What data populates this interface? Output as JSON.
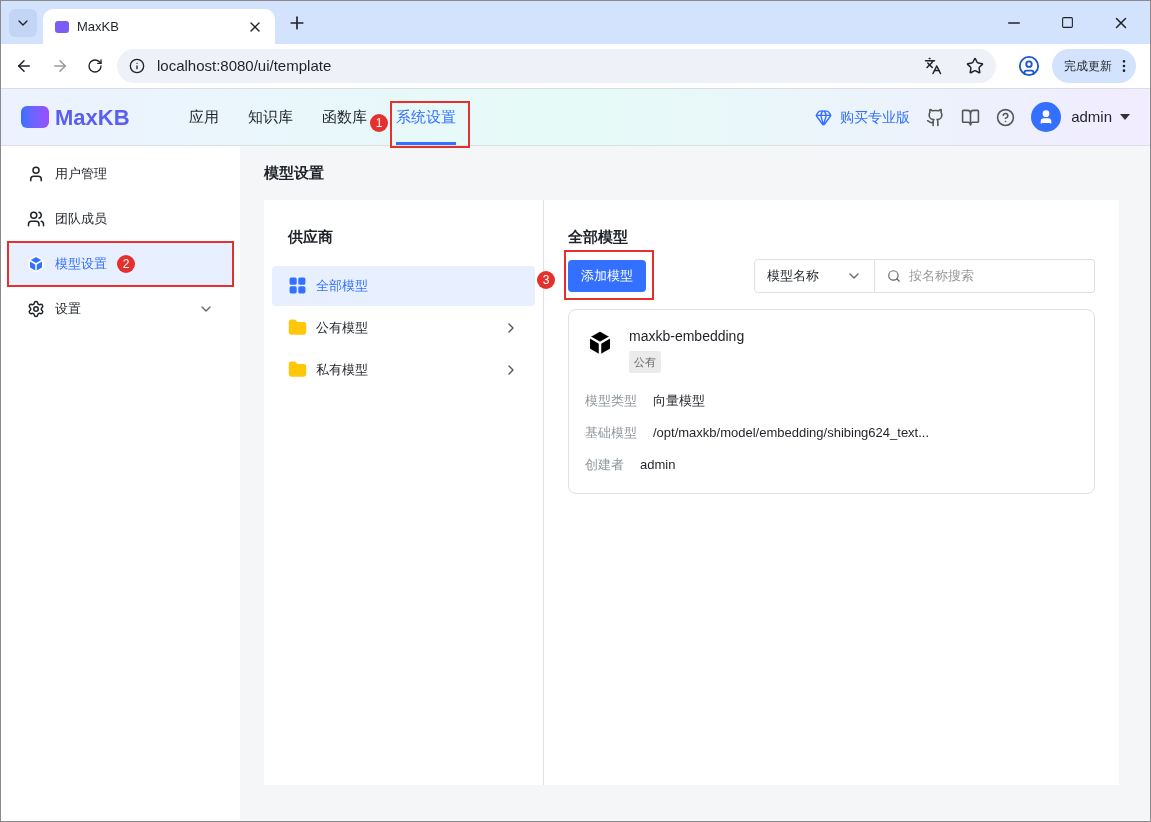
{
  "browser": {
    "tab_title": "MaxKB",
    "url": "localhost:8080/ui/template",
    "update_button": "完成更新"
  },
  "header": {
    "logo": "MaxKB",
    "nav": [
      {
        "label": "应用",
        "selected": false
      },
      {
        "label": "知识库",
        "selected": false
      },
      {
        "label": "函数库",
        "selected": false
      },
      {
        "label": "系统设置",
        "selected": true,
        "annotation": "1"
      }
    ],
    "buy_pro": "购买专业版",
    "user": "admin"
  },
  "sidebar": {
    "items": [
      {
        "label": "用户管理",
        "kind": "user",
        "selected": false
      },
      {
        "label": "团队成员",
        "kind": "team",
        "selected": false
      },
      {
        "label": "模型设置",
        "kind": "model",
        "selected": true,
        "annotation": "2"
      },
      {
        "label": "设置",
        "kind": "settings",
        "selected": false,
        "expandable": true
      }
    ]
  },
  "page_title": "模型设置",
  "providers": {
    "title": "供应商",
    "items": [
      {
        "label": "全部模型",
        "kind": "all",
        "selected": true
      },
      {
        "label": "公有模型",
        "kind": "folder",
        "selected": false
      },
      {
        "label": "私有模型",
        "kind": "folder",
        "selected": false
      }
    ]
  },
  "models": {
    "title": "全部模型",
    "add_button": {
      "label": "添加模型",
      "annotation": "3"
    },
    "filter": "模型名称",
    "search": {
      "placeholder": "按名称搜索"
    },
    "cards": [
      {
        "name": "maxkb-embedding",
        "tag": "公有",
        "fields": [
          {
            "label": "模型类型",
            "value": "向量模型"
          },
          {
            "label": "基础模型",
            "value": "/opt/maxkb/model/embedding/shibing624_text..."
          },
          {
            "label": "创建者",
            "value": "admin"
          }
        ]
      }
    ]
  }
}
